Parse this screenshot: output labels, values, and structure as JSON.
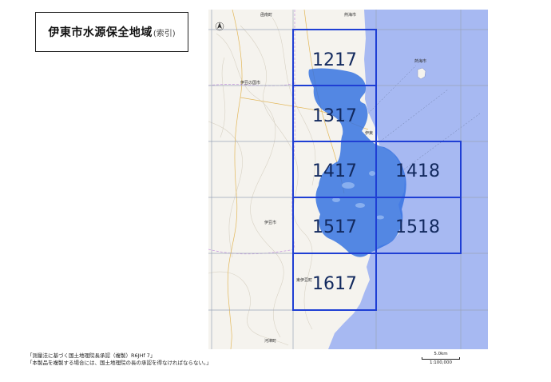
{
  "title": {
    "main": "伊東市水源保全地域",
    "sub": "(索引)"
  },
  "tiles": [
    {
      "id": "1217",
      "label": "1217"
    },
    {
      "id": "1317",
      "label": "1317"
    },
    {
      "id": "1417",
      "label": "1417"
    },
    {
      "id": "1418",
      "label": "1418"
    },
    {
      "id": "1517",
      "label": "1517"
    },
    {
      "id": "1518",
      "label": "1518"
    },
    {
      "id": "1617",
      "label": "1617"
    }
  ],
  "places": {
    "shinsaicho": "函南町",
    "atami_top": "熱海市",
    "atami_isle": "熱海市",
    "izunokuni": "伊豆の国市",
    "izu_city": "伊豆市",
    "higashiizu": "東伊豆町",
    "kawazu": "河津町",
    "ito": "伊東"
  },
  "copyright": {
    "line1": "「測量法に基づく国土地理院長承認（複製）R6JHf 7」",
    "line2": "「本製品を複製する場合には、国土地理院の長の承認を得なければならない。」"
  },
  "scale": {
    "distance": "5.0km",
    "ratio": "1:100,000"
  },
  "colors": {
    "sea": "#a7b9f2",
    "conservation": "#2f6fe0",
    "grid_blue": "#1f3fd4",
    "land": "#f5f3ee"
  }
}
